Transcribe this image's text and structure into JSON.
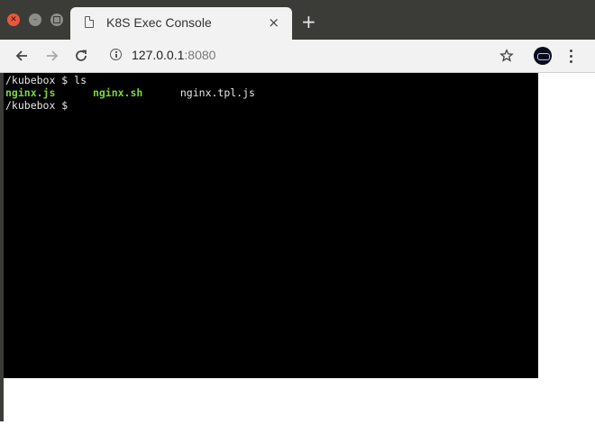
{
  "tab": {
    "title": "K8S Exec Console",
    "close_glyph": "×",
    "new_tab_glyph": "+"
  },
  "toolbar": {
    "url_host": "127.0.0.1",
    "url_port": ":8080"
  },
  "icons": {
    "back": "arrow-left-icon",
    "forward": "arrow-right-icon",
    "reload": "reload-icon",
    "info": "info-icon",
    "bookmark": "star-icon",
    "menu": "kebab-menu-icon"
  },
  "terminal": {
    "lines": [
      {
        "prompt": "/kubebox $ ",
        "command": "ls"
      },
      {
        "files": [
          "nginx.js",
          "nginx.sh",
          "nginx.tpl.js"
        ]
      },
      {
        "prompt": "/kubebox $ ",
        "command": ""
      }
    ]
  },
  "colors": {
    "terminal_bg": "#000000",
    "terminal_fg": "#e8e8e8",
    "exec_file": "#7cd442",
    "chrome_dark": "#3b3b38",
    "close_button": "#e9583b"
  }
}
